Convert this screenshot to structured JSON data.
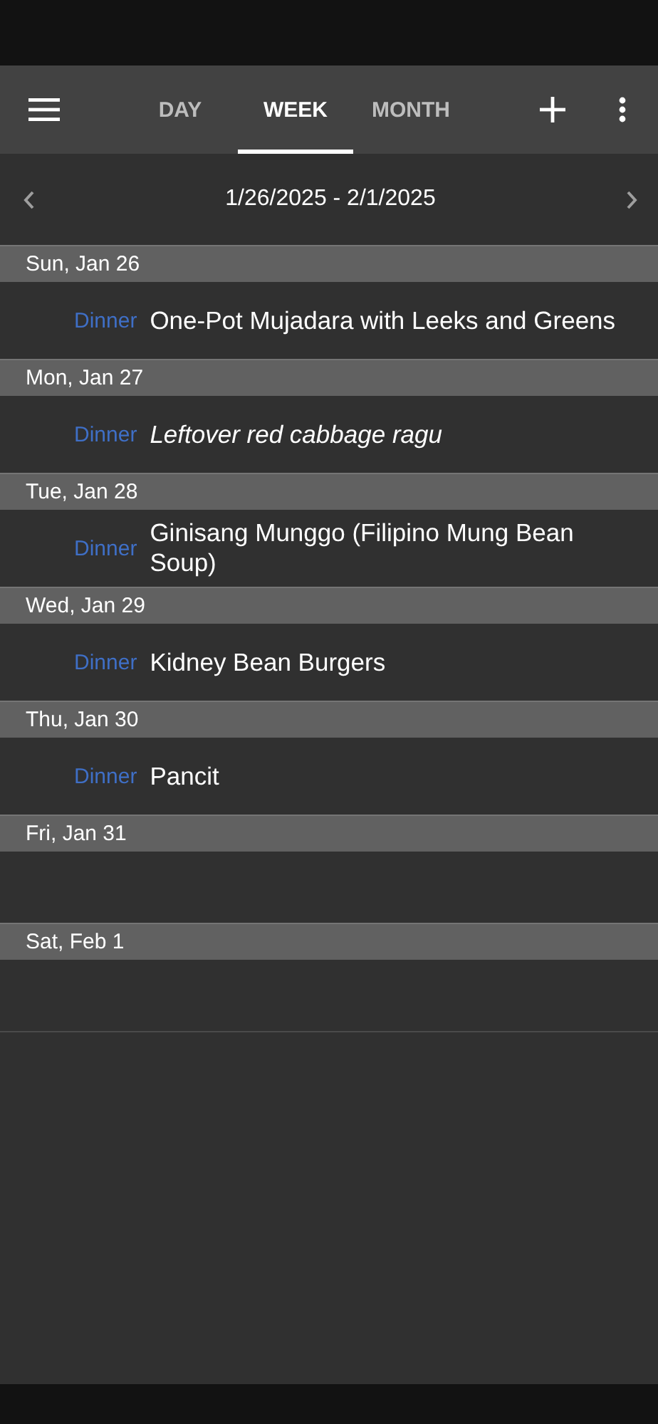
{
  "tabs": [
    {
      "label": "DAY",
      "selected": false
    },
    {
      "label": "WEEK",
      "selected": true
    },
    {
      "label": "MONTH",
      "selected": false
    }
  ],
  "date_range": "1/26/2025 - 2/1/2025",
  "days": [
    {
      "label": "Sun, Jan 26",
      "meals": [
        {
          "meal": "Dinner",
          "title": "One-Pot Mujadara with Leeks and Greens",
          "kind": "recipe"
        }
      ]
    },
    {
      "label": "Mon, Jan 27",
      "meals": [
        {
          "meal": "Dinner",
          "title": "Leftover red cabbage ragu",
          "kind": "note"
        }
      ]
    },
    {
      "label": "Tue, Jan 28",
      "meals": [
        {
          "meal": "Dinner",
          "title": "Ginisang Munggo (Filipino Mung Bean Soup)",
          "kind": "recipe"
        }
      ]
    },
    {
      "label": "Wed, Jan 29",
      "meals": [
        {
          "meal": "Dinner",
          "title": "Kidney Bean Burgers",
          "kind": "recipe"
        }
      ]
    },
    {
      "label": "Thu, Jan 30",
      "meals": [
        {
          "meal": "Dinner",
          "title": "Pancit",
          "kind": "recipe"
        }
      ]
    },
    {
      "label": "Fri, Jan 31"
    },
    {
      "label": "Sat, Feb 1"
    }
  ]
}
